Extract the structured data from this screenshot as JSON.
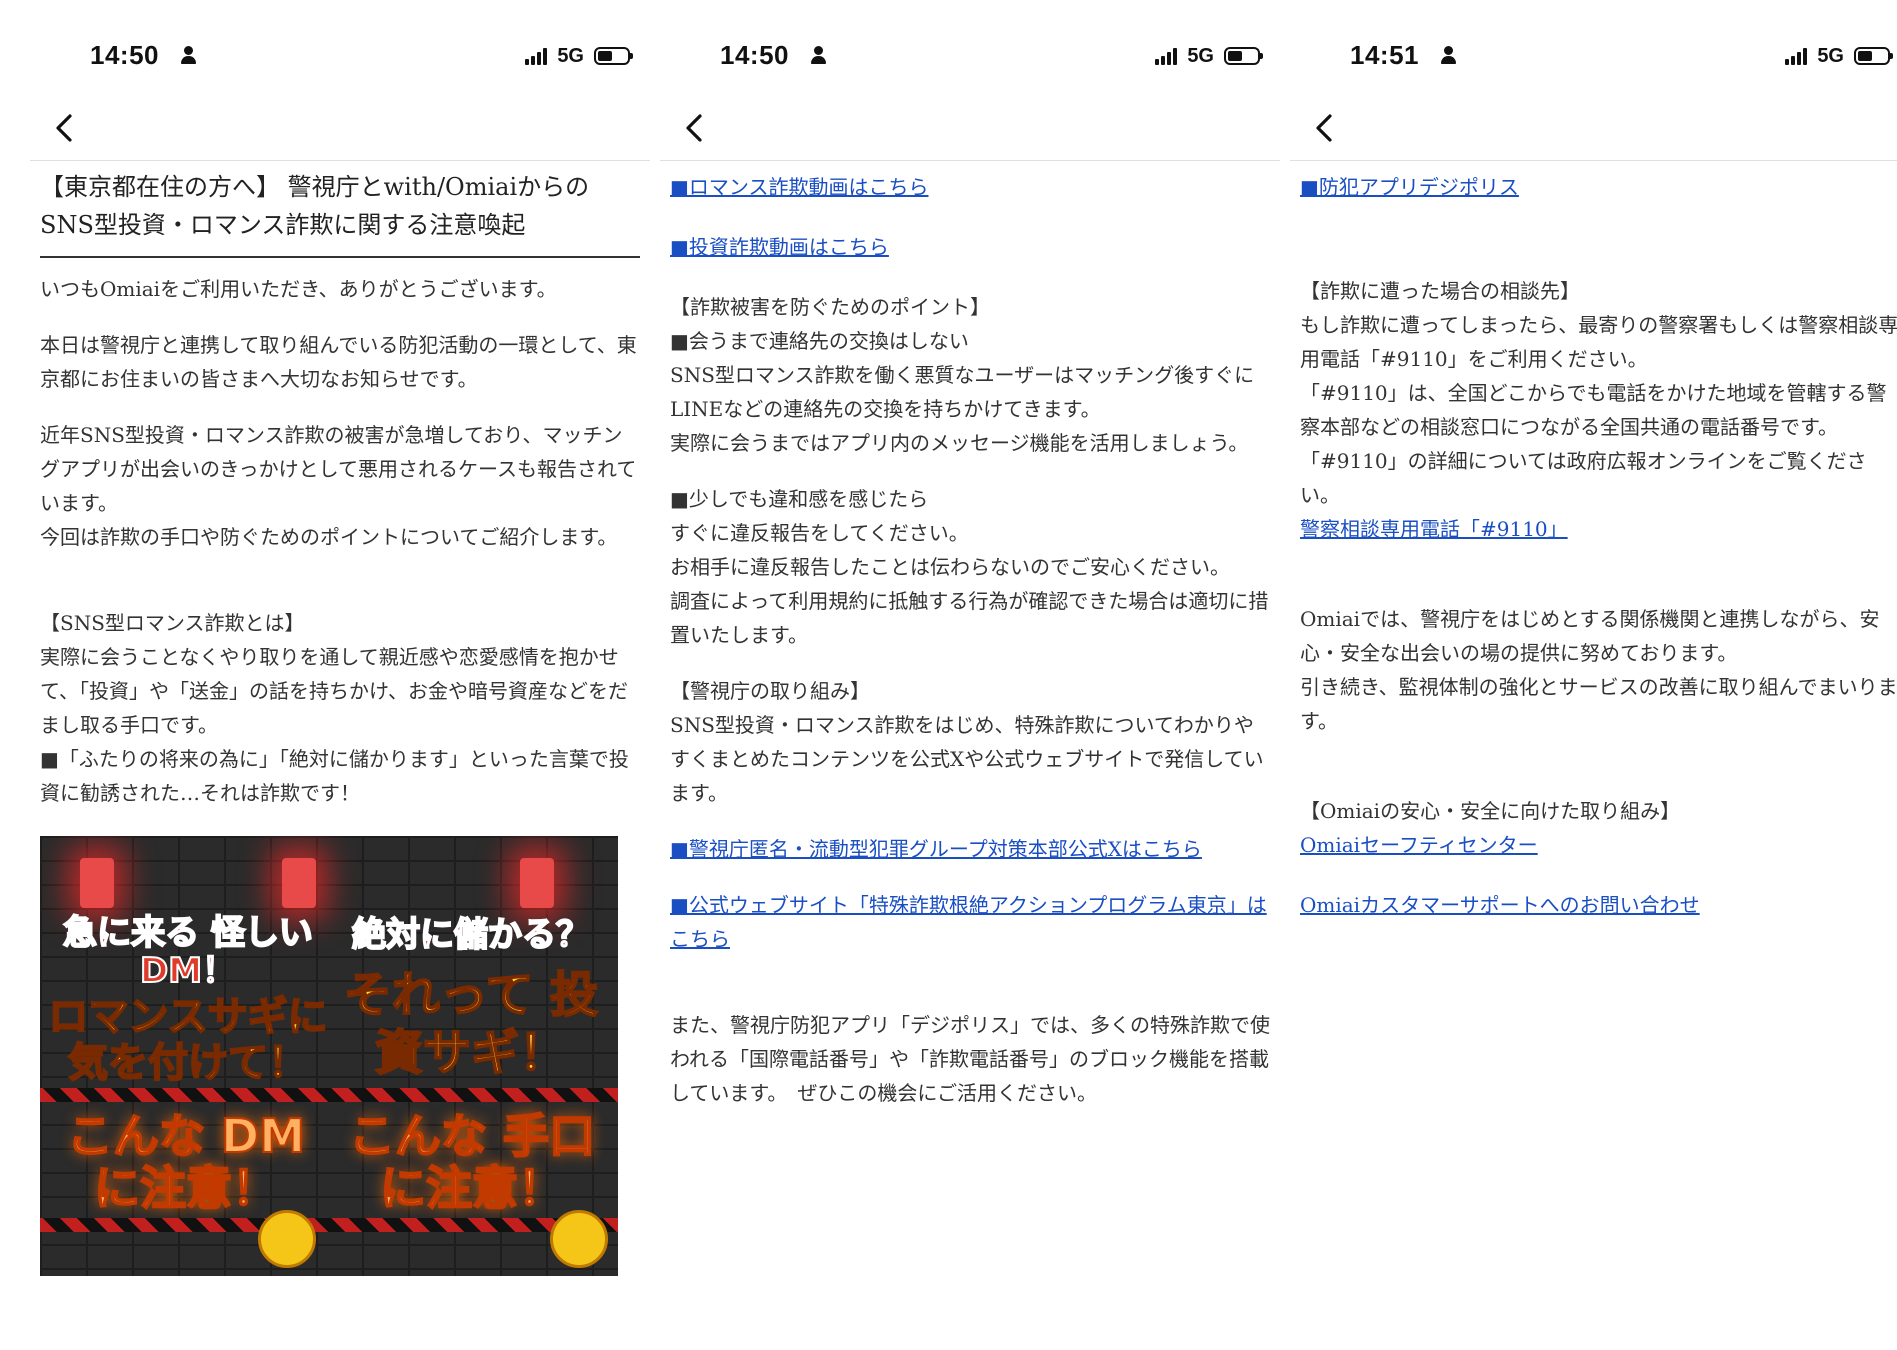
{
  "status_bars": [
    {
      "time": "14:50",
      "network": "5G"
    },
    {
      "time": "14:50",
      "network": "5G"
    },
    {
      "time": "14:51",
      "network": "5G"
    }
  ],
  "icons": {
    "back": "chevron-left-icon",
    "person": "person-icon",
    "signal": "signal-icon",
    "battery": "battery-icon"
  },
  "panel1": {
    "title": "【東京都在住の方へ】 警視庁とwith/Omiaiからの SNS型投資・ロマンス詐欺に関する注意喚起",
    "p1": "いつもOmiaiをご利用いただき、ありがとうございます。",
    "p2": "本日は警視庁と連携して取り組んでいる防犯活動の一環として、東京都にお住まいの皆さまへ大切なお知らせです。",
    "p3a": "近年SNS型投資・ロマンス詐欺の被害が急増しており、マッチングアプリが出会いのきっかけとして悪用されるケースも報告されています。",
    "p3b": "今回は詐欺の手口や防ぐためのポイントについてご紹介します。",
    "h_sns": "【SNS型ロマンス詐欺とは】",
    "p4": "実際に会うことなくやり取りを通して親近感や恋愛感情を抱かせて、「投資」や「送金」の話を持ちかけ、お金や暗号資産などをだまし取る手口です。",
    "p5": "■「ふたりの将来の為に」「絶対に儲かります」といった言葉で投資に勧誘された…それは詐欺です！",
    "banner": {
      "left_top": "急に来る 怪しいDM！",
      "left_mid": "ロマンスサギに 気を付けて！",
      "right_top": "絶対に儲かる？",
      "right_mid": "それって 投資サギ！",
      "left_bottom": "こんな DMに注意！",
      "right_bottom": "こんな 手口に注意！"
    }
  },
  "panel2": {
    "link_romance": "■ロマンス詐欺動画はこちら",
    "link_invest": "■投資詐欺動画はこちら",
    "h_points": "【詐欺被害を防ぐためのポイント】",
    "pt1_head": "■会うまで連絡先の交換はしない",
    "pt1_body": "SNS型ロマンス詐欺を働く悪質なユーザーはマッチング後すぐにLINEなどの連絡先の交換を持ちかけてきます。",
    "pt1_body2": "実際に会うまではアプリ内のメッセージ機能を活用しましょう。",
    "pt2_head": "■少しでも違和感を感じたら",
    "pt2_body1": "すぐに違反報告をしてください。",
    "pt2_body2": "お相手に違反報告したことは伝わらないのでご安心ください。",
    "pt2_body3": "調査によって利用規約に抵触する行為が確認できた場合は適切に措置いたします。",
    "h_police": "【警視庁の取り組み】",
    "police_body": "SNS型投資・ロマンス詐欺をはじめ、特殊詐欺についてわかりやすくまとめたコンテンツを公式Xや公式ウェブサイトで発信しています。",
    "link_x": "■警視庁匿名・流動型犯罪グループ対策本部公式Xはこちら",
    "link_web": "■公式ウェブサイト「特殊詐欺根絶アクションプログラム東京」はこちら",
    "app_body": "また、警視庁防犯アプリ「デジポリス」では、多くの特殊詐欺で使われる「国際電話番号」や「詐欺電話番号」のブロック機能を搭載しています。　ぜひこの機会にご活用ください。"
  },
  "panel3": {
    "link_app": "■防犯アプリデジポリス",
    "h_consult": "【詐欺に遭った場合の相談先】",
    "consult1": "もし詐欺に遭ってしまったら、最寄りの警察署もしくは警察相談専用電話「#9110」をご利用ください。",
    "consult2": "「#9110」は、全国どこからでも電話をかけた地域を管轄する警察本部などの相談窓口につながる全国共通の電話番号です。",
    "consult3": "「#9110」の詳細については政府広報オンラインをご覧ください。",
    "link_9110": "警察相談専用電話「#9110」",
    "omiai1": "Omiaiでは、警視庁をはじめとする関係機関と連携しながら、安心・安全な出会いの場の提供に努めております。",
    "omiai2": "引き続き、監視体制の強化とサービスの改善に取り組んでまいります。",
    "h_safe": "【Omiaiの安心・安全に向けた取り組み】",
    "link_safety": "Omiaiセーフティセンター",
    "link_support": "Omiaiカスタマーサポートへのお問い合わせ"
  }
}
